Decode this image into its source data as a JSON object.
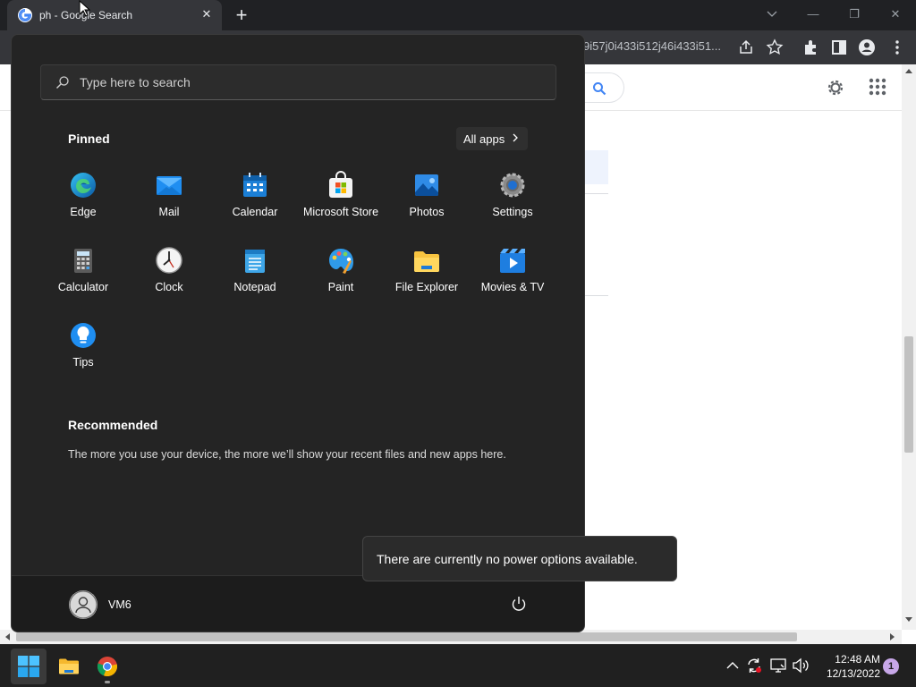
{
  "browser": {
    "tab_title": "ph - Google Search",
    "tab_close": "✕",
    "new_tab": "+",
    "url_fragment": "9i57j0i433i512j46i433i51...",
    "window": {
      "minimize": "—",
      "restore": "❐",
      "close": "✕"
    }
  },
  "start_menu": {
    "search_placeholder": "Type here to search",
    "pinned_title": "Pinned",
    "all_apps_label": "All apps",
    "pinned_apps": [
      {
        "label": "Edge",
        "icon": "edge-icon"
      },
      {
        "label": "Mail",
        "icon": "mail-icon"
      },
      {
        "label": "Calendar",
        "icon": "calendar-icon"
      },
      {
        "label": "Microsoft Store",
        "icon": "store-icon"
      },
      {
        "label": "Photos",
        "icon": "photos-icon"
      },
      {
        "label": "Settings",
        "icon": "settings-icon"
      },
      {
        "label": "Calculator",
        "icon": "calculator-icon"
      },
      {
        "label": "Clock",
        "icon": "clock-icon"
      },
      {
        "label": "Notepad",
        "icon": "notepad-icon"
      },
      {
        "label": "Paint",
        "icon": "paint-icon"
      },
      {
        "label": "File Explorer",
        "icon": "folder-icon"
      },
      {
        "label": "Movies & TV",
        "icon": "movies-icon"
      },
      {
        "label": "Tips",
        "icon": "tips-icon"
      }
    ],
    "recommended_title": "Recommended",
    "recommended_text": "The more you use your device, the more we’ll show your recent files and new apps here.",
    "user_name": "VM6",
    "power_tooltip": "There are currently no power options available."
  },
  "taskbar": {
    "time": "12:48 AM",
    "date": "12/13/2022",
    "notification_count": "1"
  },
  "colors": {
    "menu_bg": "#242424",
    "taskbar_bg": "#202020",
    "accent": "#0078d4"
  }
}
